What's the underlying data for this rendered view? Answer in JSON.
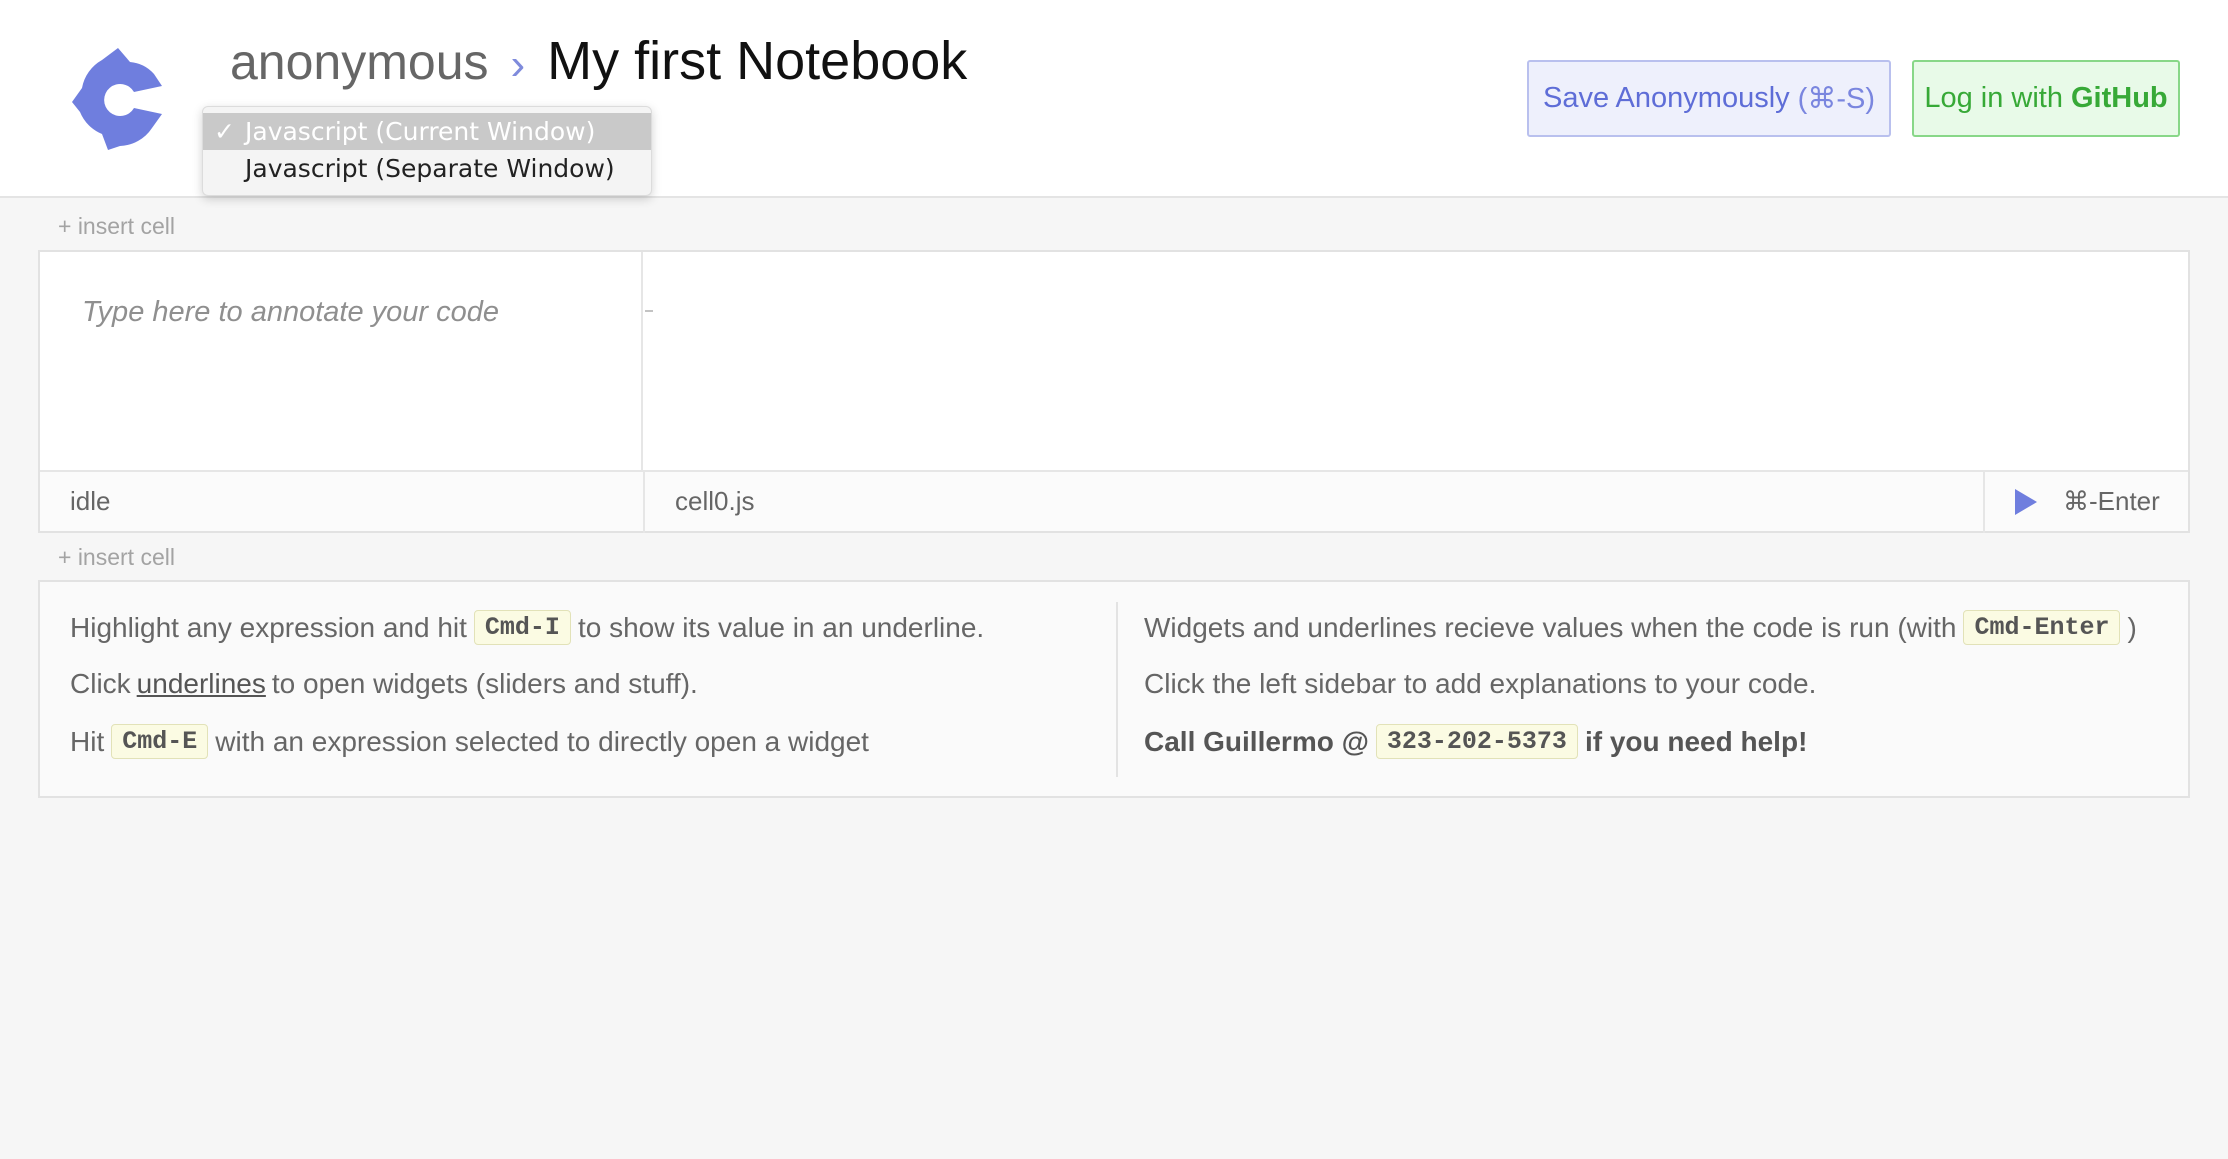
{
  "header": {
    "user": "anonymous",
    "separator": "›",
    "notebook_title": "My first Notebook",
    "save_button": {
      "label": "Save Anonymously",
      "shortcut": "(⌘-S)"
    },
    "github_button": {
      "prefix": "Log in with",
      "brand": "GitHub"
    },
    "logo_icon": "carbide-logo-icon"
  },
  "runtime_dropdown": {
    "options": [
      {
        "label": "Javascript (Current Window)",
        "selected": true
      },
      {
        "label": "Javascript (Separate Window)",
        "selected": false
      }
    ],
    "check_glyph": "✓"
  },
  "insert_cell_label": "+ insert cell",
  "cell": {
    "annotation_placeholder": "Type here to annotate your code",
    "status": "idle",
    "filename": "cell0.js",
    "run_shortcut": "⌘-Enter",
    "run_icon": "play-icon"
  },
  "help": {
    "left": {
      "line1": {
        "pre": "Highlight any expression and hit",
        "key": "Cmd-I",
        "post": "to show its value in an underline."
      },
      "line2": {
        "pre": "Click",
        "link": "underlines",
        "post": "to open widgets (sliders and stuff)."
      },
      "line3": {
        "pre": "Hit",
        "key": "Cmd-E",
        "post": "with an expression selected to directly open a widget"
      }
    },
    "right": {
      "line1": {
        "pre": "Widgets and underlines recieve values when the code is run (with",
        "key": "Cmd-Enter",
        "post": ")"
      },
      "line2": {
        "text": "Click the left sidebar to add explanations to your code."
      },
      "line3": {
        "pre": "Call Guillermo @",
        "key": "323-202-5373",
        "post": "if you need help!"
      }
    }
  },
  "colors": {
    "accent": "#6f7ede",
    "github_green": "#37a937",
    "background": "#f6f6f6"
  }
}
